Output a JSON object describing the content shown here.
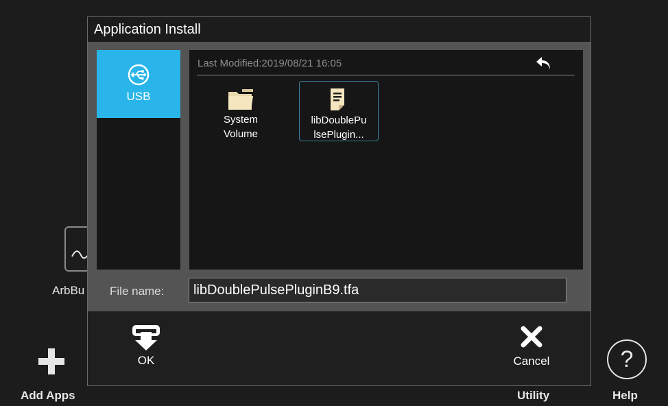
{
  "background": {
    "app_tile_label": "ArbBu",
    "add_apps_label": "Add Apps",
    "utility_label": "Utility",
    "help_label": "Help",
    "help_glyph": "?"
  },
  "dialog": {
    "title": "Application Install",
    "sources": [
      {
        "label": "USB",
        "icon": "usb-icon",
        "selected": true
      }
    ],
    "last_modified_label": "Last Modified:2019/08/21 16:05",
    "files": [
      {
        "line1": "System",
        "line2": "Volume",
        "icon": "folder-icon",
        "selected": false
      },
      {
        "line1": "libDoublePu",
        "line2": "lsePlugin...",
        "icon": "file-icon",
        "selected": true
      }
    ],
    "file_name_label": "File name:",
    "file_name_value": "libDoublePulsePluginB9.tfa",
    "ok_label": "OK",
    "cancel_label": "Cancel"
  },
  "colors": {
    "accent": "#29b5ea",
    "dialog_body": "#545454",
    "panel": "#161616"
  }
}
